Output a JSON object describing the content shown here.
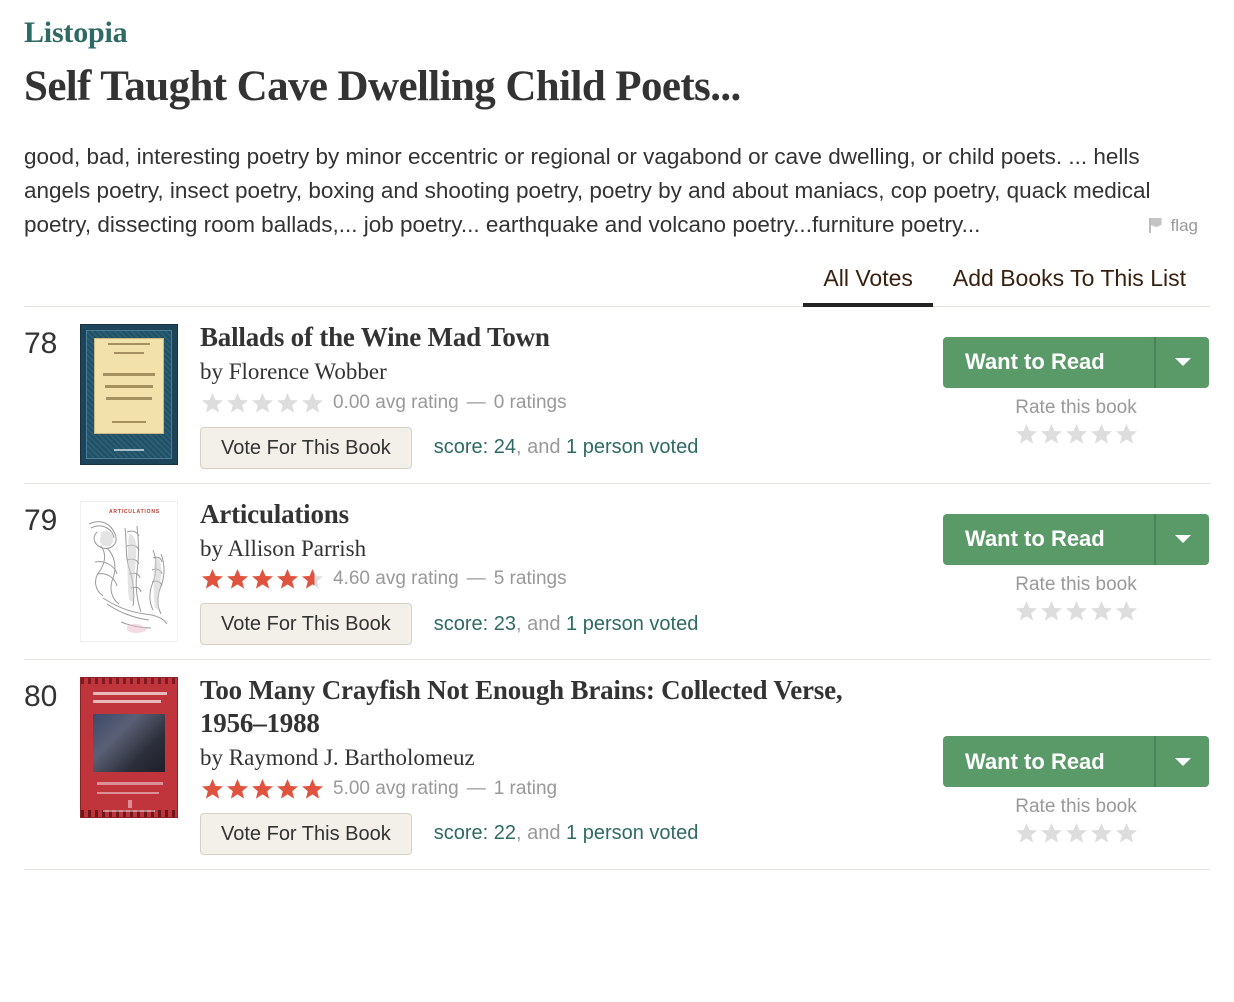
{
  "header": {
    "eyebrow": "Listopia",
    "title": "Self Taught Cave Dwelling Child Poets...",
    "description": "good, bad, interesting poetry by minor eccentric or regional or vagabond or cave dwelling, or child poets. ... hells angels poetry, insect poetry, boxing and shooting poetry, poetry by and about maniacs, cop poetry, quack medical poetry, dissecting room ballads,... job poetry... earthquake and volcano poetry...furniture poetry...",
    "flag_label": "flag"
  },
  "tabs": [
    {
      "label": "All Votes",
      "active": true
    },
    {
      "label": "Add Books To This List",
      "active": false
    }
  ],
  "colors": {
    "accent_green": "#2e6a63",
    "button_green": "#5a9a68",
    "star_red": "#e0533f",
    "star_gray": "#dddddd",
    "muted": "#999999"
  },
  "actions": {
    "want_to_read": "Want to Read",
    "rate_this_book": "Rate this book",
    "vote_button": "Vote For This Book",
    "caret": "chevron-down-icon"
  },
  "books": [
    {
      "rank": "78",
      "title": "Ballads of the Wine Mad Town",
      "by": "by",
      "author": "Florence Wobber",
      "rating_value": 0.0,
      "rating_text": "0.00 avg rating",
      "ratings_count_text": "0 ratings",
      "separator": "—",
      "score_prefix": "score:",
      "score": "24",
      "score_mid": ", and",
      "voters": "1 person voted",
      "cover_style": "ballads"
    },
    {
      "rank": "79",
      "title": "Articulations",
      "by": "by",
      "author": "Allison Parrish",
      "rating_value": 4.6,
      "rating_text": "4.60 avg rating",
      "ratings_count_text": "5 ratings",
      "separator": "—",
      "score_prefix": "score:",
      "score": "23",
      "score_mid": ", and",
      "voters": "1 person voted",
      "cover_style": "articulations"
    },
    {
      "rank": "80",
      "title": "Too Many Crayfish Not Enough Brains: Collected Verse, 1956–1988",
      "by": "by",
      "author": "Raymond J. Bartholomeuz",
      "rating_value": 5.0,
      "rating_text": "5.00 avg rating",
      "ratings_count_text": "1 rating",
      "separator": "—",
      "score_prefix": "score:",
      "score": "22",
      "score_mid": ", and",
      "voters": "1 person voted",
      "cover_style": "crayfish"
    }
  ]
}
